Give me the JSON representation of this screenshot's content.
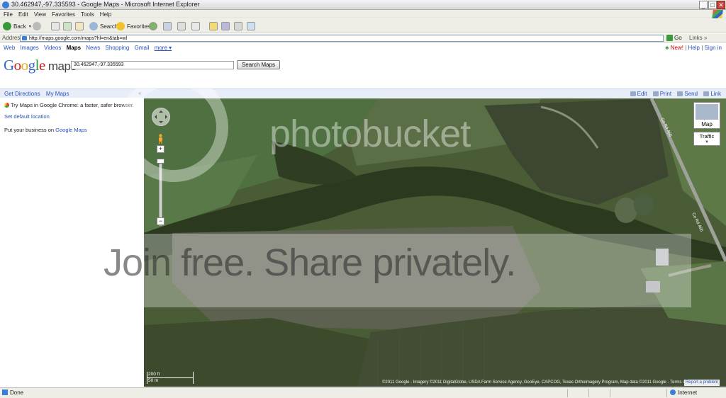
{
  "window": {
    "title": "30.462947,-97.335593 - Google Maps - Microsoft Internet Explorer",
    "min": "_",
    "max": "□",
    "close": "✕"
  },
  "menu": [
    "File",
    "Edit",
    "View",
    "Favorites",
    "Tools",
    "Help"
  ],
  "toolbar": {
    "back": "Back",
    "search": "Search",
    "favorites": "Favorites"
  },
  "address": {
    "label": "Address",
    "url": "http://maps.google.com/maps?hl=en&tab=wl",
    "go": "Go",
    "links": "Links"
  },
  "gnav": {
    "items": [
      "Web",
      "Images",
      "Videos",
      "Maps",
      "News",
      "Shopping",
      "Gmail",
      "more ▾"
    ],
    "new": "New!",
    "help": "Help",
    "signin": "Sign in",
    "sep": "|"
  },
  "logo": {
    "google": "Google",
    "maps": "maps"
  },
  "search": {
    "value": "30.462947,-97.335593",
    "button": "Search Maps"
  },
  "panel": {
    "directions": "Get Directions",
    "mymaps": "My Maps",
    "collapse": "«",
    "edit": "Edit",
    "print": "Print",
    "send": "Send",
    "link": "Link"
  },
  "left": {
    "chrome": "Try Maps in Google Chrome: a faster, safer browser.",
    "setloc": "Set default location",
    "biz_prefix": "Put your business on ",
    "biz_link": "Google Maps"
  },
  "map": {
    "type_label": "Map",
    "traffic": "Traffic",
    "scale_ft": "200 ft",
    "scale_m": "50 m",
    "road1": "Co Rd 466",
    "road2": "Co Rd 466",
    "copyright": "©2011 Google - Imagery ©2011 DigitalGlobe, USDA Farm Service Agency, GeoEye, CAPCOG, Texas Orthoimagery Program, Map data ©2011 Google - Terms of Use",
    "report": "Report a problem"
  },
  "watermark": {
    "top": "photobucket",
    "bottom": "Join free. Share privately."
  },
  "status": {
    "done": "Done",
    "zone": "Internet"
  },
  "colors": {
    "link": "#2a52be",
    "field_dark": "#3e4a2c",
    "field_green": "#4a6b35",
    "trees": "#2c3a1e"
  }
}
